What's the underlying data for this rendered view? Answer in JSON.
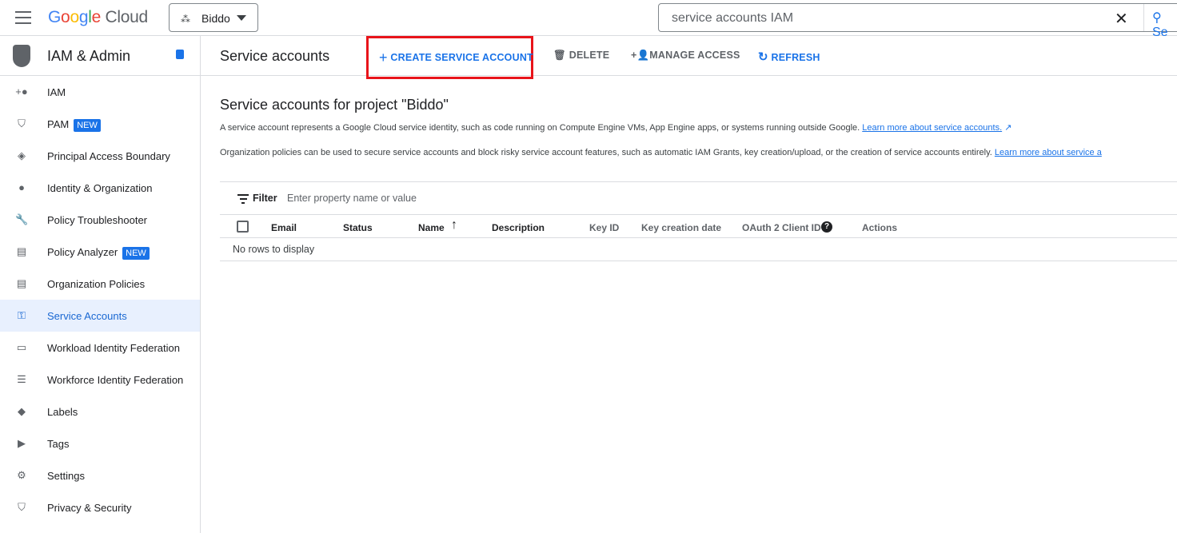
{
  "header": {
    "logo": "Google Cloud",
    "project": "Biddo",
    "search_value": "service accounts IAM",
    "search_button": "Se"
  },
  "sidebar": {
    "title": "IAM & Admin",
    "items": [
      {
        "label": "IAM",
        "icon": "person-add-icon"
      },
      {
        "label": "PAM",
        "badge": "NEW",
        "icon": "shield-icon"
      },
      {
        "label": "Principal Access Boundary",
        "icon": "policy-icon"
      },
      {
        "label": "Identity & Organization",
        "icon": "account-circle-icon"
      },
      {
        "label": "Policy Troubleshooter",
        "icon": "wrench-icon"
      },
      {
        "label": "Policy Analyzer",
        "badge": "NEW",
        "icon": "document-search-icon"
      },
      {
        "label": "Organization Policies",
        "icon": "list-doc-icon"
      },
      {
        "label": "Service Accounts",
        "icon": "service-account-icon",
        "active": true
      },
      {
        "label": "Workload Identity Federation",
        "icon": "id-card-icon"
      },
      {
        "label": "Workforce Identity Federation",
        "icon": "list-icon"
      },
      {
        "label": "Labels",
        "icon": "tag-icon"
      },
      {
        "label": "Tags",
        "icon": "label-arrow-icon"
      },
      {
        "label": "Settings",
        "icon": "gear-icon"
      },
      {
        "label": "Privacy & Security",
        "icon": "shield-icon"
      }
    ]
  },
  "toolbar": {
    "title": "Service accounts",
    "create": "CREATE SERVICE ACCOUNT",
    "delete": "DELETE",
    "manage": "MANAGE ACCESS",
    "refresh": "REFRESH"
  },
  "content": {
    "heading": "Service accounts for project \"Biddo\"",
    "p1": "A service account represents a Google Cloud service identity, such as code running on Compute Engine VMs, App Engine apps, or systems running outside Google.",
    "p1_link": "Learn more about service accounts.",
    "p2": "Organization policies can be used to secure service accounts and block risky service account features, such as automatic IAM Grants, key creation/upload, or the creation of service accounts entirely.",
    "p2_link": "Learn more about service a",
    "filter_label": "Filter",
    "filter_placeholder": "Enter property name or value",
    "columns": [
      "Email",
      "Status",
      "Name",
      "Description",
      "Key ID",
      "Key creation date",
      "OAuth 2 Client ID",
      "Actions"
    ],
    "empty": "No rows to display"
  },
  "colors": {
    "accent": "#1a73e8",
    "highlight": "#e8141a"
  }
}
